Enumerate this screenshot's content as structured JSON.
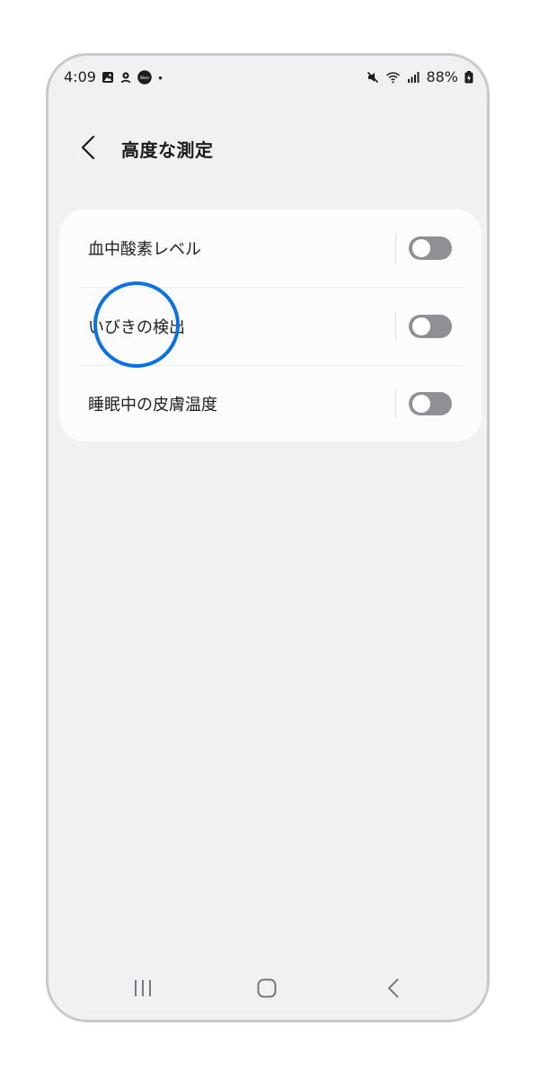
{
  "status_bar": {
    "time": "4:09",
    "battery": "88%",
    "left_icons": [
      "gallery-icon",
      "location-icon",
      "wear-icon",
      "dot-icon"
    ],
    "wear_text": "Wear",
    "right_icons": [
      "mute-icon",
      "wifi-icon",
      "signal-icon",
      "battery-icon"
    ]
  },
  "header": {
    "back_icon": "chevron-left-icon",
    "title": "高度な測定"
  },
  "settings": {
    "items": [
      {
        "label": "血中酸素レベル",
        "enabled": false
      },
      {
        "label": "いびきの検出",
        "enabled": false
      },
      {
        "label": "睡眠中の皮膚温度",
        "enabled": false
      }
    ]
  },
  "nav_bar": {
    "icons": [
      "recents-icon",
      "home-icon",
      "back-icon"
    ]
  },
  "colors": {
    "background": "#f1f1f3",
    "card": "#fcfcfd",
    "toggle_off": "#8f8f94",
    "highlight": "#0a72e4"
  }
}
